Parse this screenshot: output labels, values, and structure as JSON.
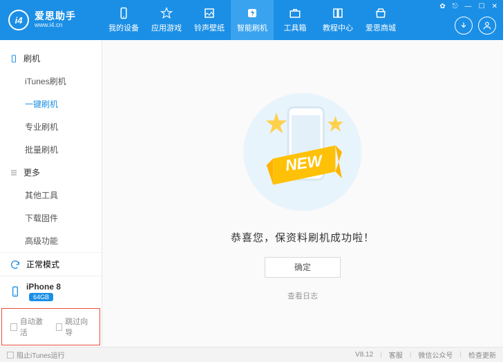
{
  "brand": {
    "badge": "i4",
    "title": "爱思助手",
    "subtitle": "www.i4.cn"
  },
  "nav": [
    {
      "name": "my-device",
      "label": "我的设备"
    },
    {
      "name": "app-games",
      "label": "应用游戏"
    },
    {
      "name": "ring-wall",
      "label": "铃声壁纸"
    },
    {
      "name": "smart-flash",
      "label": "智能刷机",
      "active": true
    },
    {
      "name": "toolbox",
      "label": "工具箱"
    },
    {
      "name": "tutorial",
      "label": "教程中心"
    },
    {
      "name": "store",
      "label": "爱思商城"
    }
  ],
  "win": {
    "settings": "⚙",
    "lock": "🔒",
    "min": "—",
    "max": "▢",
    "close": "✕"
  },
  "sidebar": {
    "group1": "刷机",
    "g1items": [
      "iTunes刷机",
      "一键刷机",
      "专业刷机",
      "批量刷机"
    ],
    "group2": "更多",
    "g2items": [
      "其他工具",
      "下载固件",
      "高级功能"
    ],
    "mode": "正常模式",
    "device": "iPhone 8",
    "storage": "64GB",
    "check1": "自动激活",
    "check2": "跳过向导"
  },
  "main": {
    "ribbon": "NEW",
    "success": "恭喜您，保资料刷机成功啦！",
    "confirm": "确定",
    "log": "查看日志"
  },
  "footer": {
    "block_itunes": "阻止iTunes运行",
    "version": "V8.12",
    "support": "客服",
    "wechat": "微信公众号",
    "update": "检查更新"
  }
}
